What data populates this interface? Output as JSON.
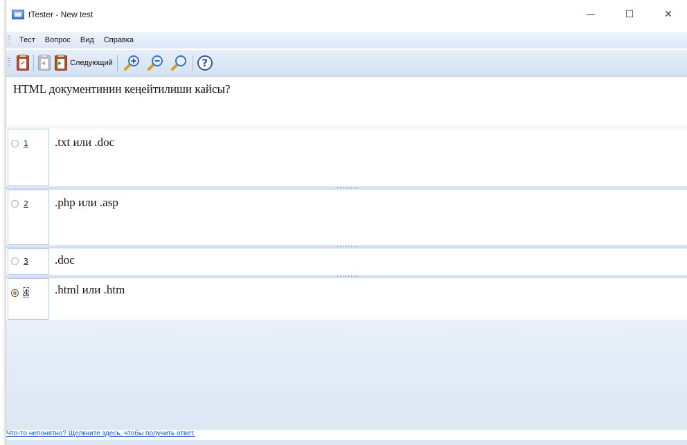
{
  "window": {
    "title": "tTester - New test",
    "controls": {
      "minimize": "—",
      "maximize": "☐",
      "close": "✕"
    }
  },
  "menu": {
    "items": [
      "Тест",
      "Вопрос",
      "Вид",
      "Справка"
    ]
  },
  "toolbar": {
    "next_label": "Следующий"
  },
  "question": {
    "text": "HTML документинин кеңейтилиши кайсы?"
  },
  "answers": [
    {
      "number": "1",
      "text": ".txt или .doc",
      "selected": false
    },
    {
      "number": "2",
      "text": ".php или .asp",
      "selected": false
    },
    {
      "number": "3",
      "text": ".doc",
      "selected": false
    },
    {
      "number": "4",
      "text": ".html или .htm",
      "selected": true
    }
  ],
  "footer": {
    "help_link": "Что-то непонятно? Щелкните здесь, чтобы получить ответ."
  },
  "colors": {
    "selected_radio": "#e07a0a",
    "link": "#1a4fd6",
    "toolbar_bg": "#dbe7f6"
  }
}
